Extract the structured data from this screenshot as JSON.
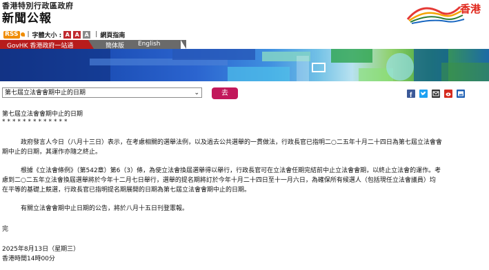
{
  "header": {
    "gov_name": "香港特別行政區政府",
    "site_name": "新聞公報",
    "brand_text": "香港"
  },
  "toolbar": {
    "rss": "RSS",
    "font_size_label": "字體大小 :",
    "font_a": "A",
    "accessibility": "網頁指南"
  },
  "nav": {
    "gov_hk": "GovHK 香港政府一站通",
    "simplified": "簡体版",
    "english": "English"
  },
  "select": {
    "value": "第七屆立法會會期中止的日期",
    "go_label": "去"
  },
  "colors": {
    "facebook": "#3b5998",
    "twitter": "#1da1f2",
    "email": "#333333",
    "weibo": "#d52b1e",
    "photo": "#1e5fb3",
    "go_button": "#c2185b",
    "rss": "#f08c00"
  },
  "share_icons": [
    "facebook-icon",
    "twitter-icon",
    "email-icon",
    "weibo-icon",
    "image-icon"
  ],
  "article": {
    "title": "第七屆立法會會期中止的日期",
    "stars": "*************",
    "p1_a": "政府發言人今日（八月十三日）表示，在考慮相關的選舉法例，以及過去公共選舉的一貫做法，行政長官已指明二○二五年十月二十四日為第七屆立法會會",
    "p1_b": "期中止的日期，其運作亦隨之終止。",
    "p2_a": "根據《立法會條例》（第542章）第6（3）條，為使立法會換屆選舉得以舉行，行政長官可在立法會任期完結前中止立法會會期，以終止立法會的運作。考",
    "p2_b": "慮到二○二五年立法會換屆選舉將於今年十二月七日舉行，選舉的提名期將訂於今年十月二十四日至十一月六日，為確保所有候選人（包括現任立法會議員）均",
    "p2_c": "在平等的基礎上競選，行政長官已指明提名期展開的日期為第七屆立法會會期中止的日期。",
    "p3": "有關立法會會期中止日期的公告，將於八月十五日刊登憲報。",
    "end": "完",
    "date": "2025年8月13日（星期三）",
    "time": "香港時間14時00分"
  }
}
